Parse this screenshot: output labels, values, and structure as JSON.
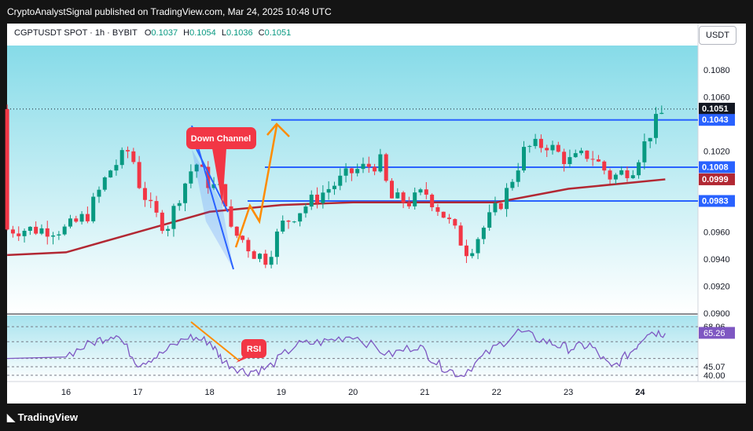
{
  "header": {
    "publish_line": "CryptoAnalystSignal published on TradingView.com, Mar 24, 2025 10:48 UTC"
  },
  "symbol": {
    "name": "CGPTUSDT SPOT · 1h · BYBIT",
    "open_label": "O",
    "open": "0.1037",
    "high_label": "H",
    "high": "0.1054",
    "low_label": "L",
    "low": "0.1036",
    "close_label": "C",
    "close": "0.1051"
  },
  "currency_button": "USDT",
  "footer": {
    "logo_text": "TradingView"
  },
  "colors": {
    "up": "#089981",
    "down": "#f23645",
    "ma": "#b22833",
    "level_line": "#2962ff",
    "arrow": "#ff8c00",
    "rsi": "#7e57c2",
    "callout": "#f23645",
    "bg_top": "#86dbe8",
    "bg_bottom": "#ffffff"
  },
  "annotations": {
    "down_channel": "Down Channel",
    "rsi_label": "RSI"
  },
  "chart_data": {
    "type": "candlestick",
    "symbol": "CGPTUSDT",
    "interval": "1h",
    "x_ticks": [
      "16",
      "17",
      "18",
      "19",
      "20",
      "21",
      "22",
      "23",
      "24"
    ],
    "y_ticks": [
      "0.1080",
      "0.1060",
      "0.1020",
      "0.0960",
      "0.0940",
      "0.0920",
      "0.0900"
    ],
    "ylim": [
      0.09,
      0.109
    ],
    "price_tags": [
      {
        "value": "0.1051",
        "sub": "11:29",
        "kind": "last"
      },
      {
        "value": "0.1043",
        "kind": "level"
      },
      {
        "value": "0.1008",
        "kind": "level"
      },
      {
        "value": "0.0999",
        "kind": "ma"
      },
      {
        "value": "0.0983",
        "kind": "level"
      }
    ],
    "horizontal_levels": [
      0.1043,
      0.1008,
      0.0983
    ],
    "close_path": [
      {
        "x": 0,
        "y": 0.0962
      },
      {
        "x": 0.3,
        "y": 0.0973
      },
      {
        "x": 0.6,
        "y": 0.1005
      },
      {
        "x": 0.9,
        "y": 0.1022
      },
      {
        "x": 1.0,
        "y": 0.0998
      },
      {
        "x": 1.2,
        "y": 0.0975
      },
      {
        "x": 1.4,
        "y": 0.0963
      },
      {
        "x": 1.6,
        "y": 0.099
      },
      {
        "x": 1.8,
        "y": 0.1012
      },
      {
        "x": 2.0,
        "y": 0.0995
      },
      {
        "x": 2.2,
        "y": 0.099
      },
      {
        "x": 2.3,
        "y": 0.096
      },
      {
        "x": 2.45,
        "y": 0.0955
      },
      {
        "x": 2.6,
        "y": 0.0945
      },
      {
        "x": 2.8,
        "y": 0.094
      },
      {
        "x": 3.0,
        "y": 0.0965
      },
      {
        "x": 3.3,
        "y": 0.0978
      },
      {
        "x": 3.6,
        "y": 0.099
      },
      {
        "x": 4.0,
        "y": 0.1005
      },
      {
        "x": 4.4,
        "y": 0.1012
      },
      {
        "x": 4.5,
        "y": 0.0985
      },
      {
        "x": 4.8,
        "y": 0.0982
      },
      {
        "x": 5.0,
        "y": 0.099
      },
      {
        "x": 5.3,
        "y": 0.097
      },
      {
        "x": 5.6,
        "y": 0.0945
      },
      {
        "x": 5.9,
        "y": 0.097
      },
      {
        "x": 6.1,
        "y": 0.0985
      },
      {
        "x": 6.4,
        "y": 0.1022
      },
      {
        "x": 6.7,
        "y": 0.1025
      },
      {
        "x": 7.0,
        "y": 0.1012
      },
      {
        "x": 7.3,
        "y": 0.1018
      },
      {
        "x": 7.6,
        "y": 0.1
      },
      {
        "x": 7.9,
        "y": 0.1008
      },
      {
        "x": 8.2,
        "y": 0.104
      },
      {
        "x": 8.35,
        "y": 0.1051
      }
    ],
    "ma_path": [
      {
        "x": 0,
        "y": 0.0945
      },
      {
        "x": 1.0,
        "y": 0.096
      },
      {
        "x": 2.0,
        "y": 0.0975
      },
      {
        "x": 3.0,
        "y": 0.098
      },
      {
        "x": 4.0,
        "y": 0.0982
      },
      {
        "x": 5.0,
        "y": 0.0982
      },
      {
        "x": 6.0,
        "y": 0.0982
      },
      {
        "x": 7.0,
        "y": 0.0992
      },
      {
        "x": 8.35,
        "y": 0.0999
      }
    ],
    "rsi": {
      "levels": [
        "68.96",
        "65.26",
        "45.07",
        "40.00"
      ],
      "series": [
        {
          "x": 0,
          "y": 52
        },
        {
          "x": 0.4,
          "y": 60
        },
        {
          "x": 0.7,
          "y": 65
        },
        {
          "x": 1.0,
          "y": 47
        },
        {
          "x": 1.3,
          "y": 52
        },
        {
          "x": 1.7,
          "y": 63
        },
        {
          "x": 2.0,
          "y": 60
        },
        {
          "x": 2.2,
          "y": 48
        },
        {
          "x": 2.5,
          "y": 42
        },
        {
          "x": 2.8,
          "y": 44
        },
        {
          "x": 3.2,
          "y": 58
        },
        {
          "x": 3.6,
          "y": 60
        },
        {
          "x": 4.0,
          "y": 64
        },
        {
          "x": 4.5,
          "y": 52
        },
        {
          "x": 4.9,
          "y": 58
        },
        {
          "x": 5.2,
          "y": 46
        },
        {
          "x": 5.5,
          "y": 40
        },
        {
          "x": 5.9,
          "y": 54
        },
        {
          "x": 6.3,
          "y": 66
        },
        {
          "x": 6.7,
          "y": 60
        },
        {
          "x": 7.0,
          "y": 56
        },
        {
          "x": 7.3,
          "y": 58
        },
        {
          "x": 7.6,
          "y": 44
        },
        {
          "x": 7.9,
          "y": 55
        },
        {
          "x": 8.1,
          "y": 66
        },
        {
          "x": 8.35,
          "y": 65
        }
      ]
    }
  }
}
